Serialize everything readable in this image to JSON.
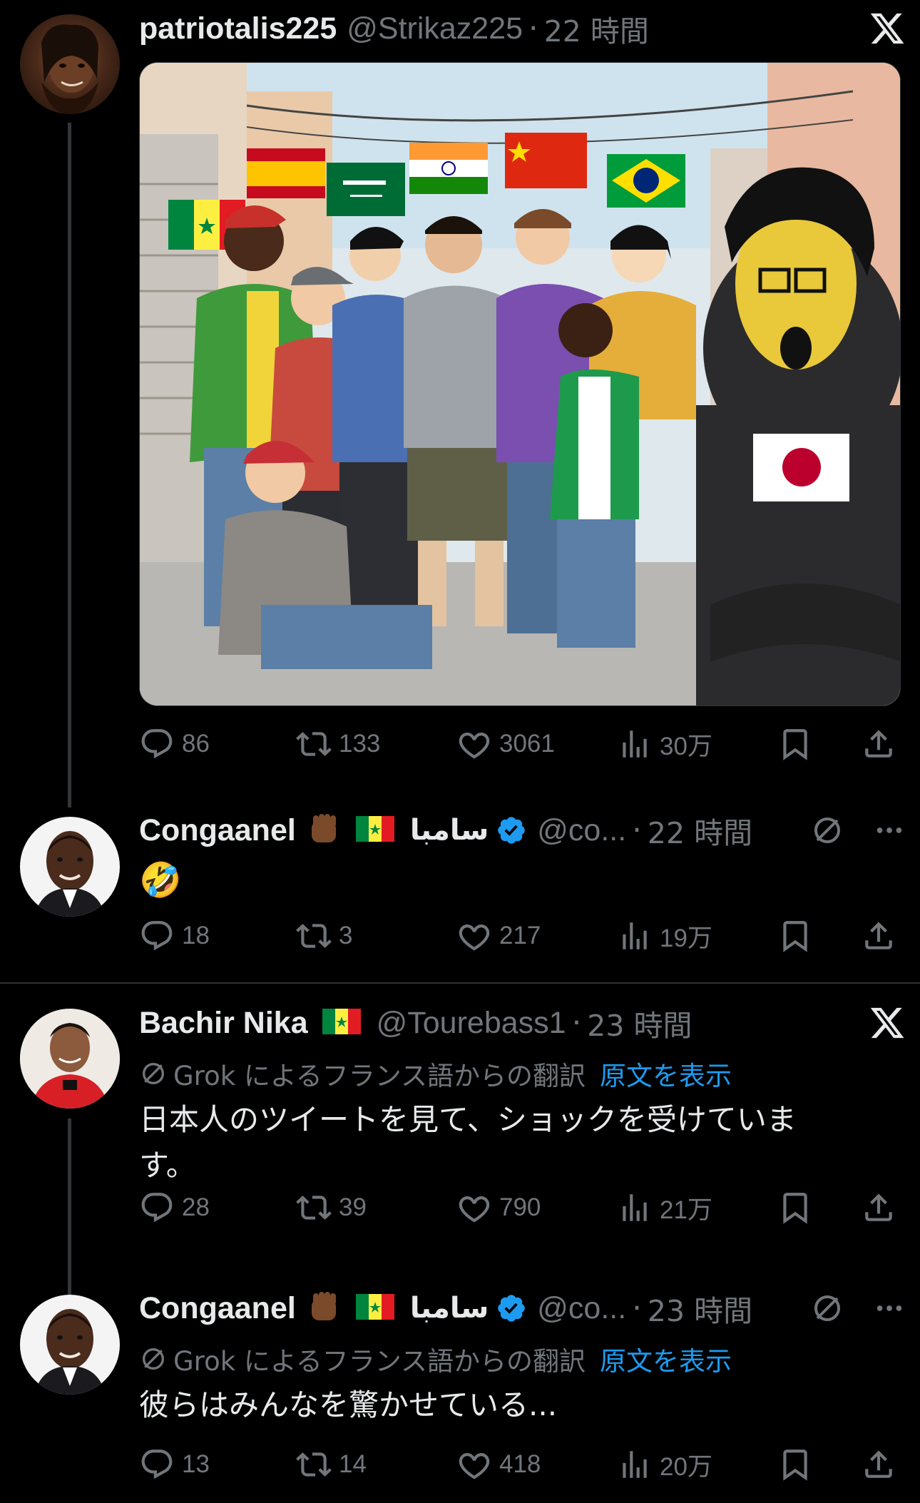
{
  "tweets": [
    {
      "name": "patriotalis225",
      "handle": "@Strikaz225",
      "time": "22 時間",
      "actions": {
        "reply": "86",
        "repost": "133",
        "like": "3061",
        "views": "30万"
      }
    },
    {
      "name": "Congaanel",
      "name_arabic": "سامبا",
      "handle": "@co...",
      "time": "22 時間",
      "text": "🤣",
      "actions": {
        "reply": "18",
        "repost": "3",
        "like": "217",
        "views": "19万"
      }
    },
    {
      "name": "Bachir Nika",
      "handle": "@Tourebass1",
      "time": "23 時間",
      "translation_note": "Grok によるフランス語からの翻訳",
      "show_original": "原文を表示",
      "text": "日本人のツイートを見て、ショックを受けていま す。",
      "actions": {
        "reply": "28",
        "repost": "39",
        "like": "790",
        "views": "21万"
      }
    },
    {
      "name": "Congaanel",
      "name_arabic": "سامبا",
      "handle": "@co...",
      "time": "23 時間",
      "translation_note": "Grok によるフランス語からの翻訳",
      "show_original": "原文を表示",
      "text": "彼らはみんなを驚かせている...",
      "actions": {
        "reply": "13",
        "repost": "14",
        "like": "418",
        "views": "20万"
      }
    }
  ],
  "colors": {
    "background": "#000000",
    "text": "#e7e9ea",
    "muted": "#71767b",
    "link": "#1d9bf0",
    "verified": "#1d9bf0"
  }
}
